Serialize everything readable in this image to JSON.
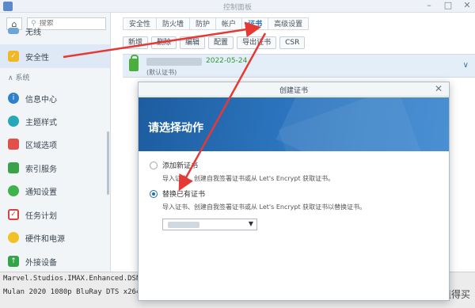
{
  "window": {
    "title": "控制面板",
    "minimize": "–",
    "maximize": "□",
    "close": "✕"
  },
  "sidebar": {
    "home_icon": "⌂",
    "search_placeholder": "搜索",
    "items": [
      {
        "label": "无线",
        "icon": "wifi-icon",
        "color": "#6da5d8"
      },
      {
        "label": "安全性",
        "icon": "shield-icon",
        "color": "#f0b824"
      },
      {
        "label": "信息中心",
        "icon": "info-icon",
        "color": "#2f82c9"
      },
      {
        "label": "主题样式",
        "icon": "palette-icon",
        "color": "#27a8b8"
      },
      {
        "label": "区域选项",
        "icon": "calendar-icon",
        "color": "#e2504a"
      },
      {
        "label": "索引服务",
        "icon": "index-icon",
        "color": "#3aa34a"
      },
      {
        "label": "通知设置",
        "icon": "chat-icon",
        "color": "#3fb34a"
      },
      {
        "label": "任务计划",
        "icon": "task-icon",
        "color": "#d9423d"
      },
      {
        "label": "硬件和电源",
        "icon": "bulb-icon",
        "color": "#f2c125"
      },
      {
        "label": "外接设备",
        "icon": "device-icon",
        "color": "#33a44a"
      }
    ],
    "group_label": "系统",
    "group_arrow": "∧"
  },
  "tabs": [
    {
      "label": "安全性",
      "active": false
    },
    {
      "label": "防火墙",
      "active": false
    },
    {
      "label": "防护",
      "active": false
    },
    {
      "label": "帐户",
      "active": false
    },
    {
      "label": "证书",
      "active": true
    },
    {
      "label": "高级设置",
      "active": false
    }
  ],
  "toolbar": [
    "新增",
    "删除",
    "编辑",
    "配置",
    "导出证书",
    "CSR"
  ],
  "certificate": {
    "date": "2022-05-24",
    "default_label": "(默认证书)"
  },
  "modal": {
    "title": "创建证书",
    "close": "✕",
    "heading": "请选择动作",
    "options": [
      {
        "label": "添加新证书",
        "checked": false,
        "description": "导入证书、创建自我签署证书或从 Let's Encrypt 获取证书。"
      },
      {
        "label": "替换已有证书",
        "checked": true,
        "description": "导入证书、创建自我签署证书或从 Let's Encrypt 获取证书以替换证书。"
      }
    ],
    "select_caret": "▼"
  },
  "bottom": {
    "line1": "Marvel.Studios.IMAX.Enhanced.DSNP.WEB-DL.x",
    "line2": "Mulan 2020 1080p BluRay DTS x264-LHD",
    "watermark": "什么值得买",
    "watermark_badge": "值"
  },
  "colors": {
    "accent": "#1b6fb8",
    "annotation": "#e53935",
    "valid_date": "#2f9a2f"
  }
}
